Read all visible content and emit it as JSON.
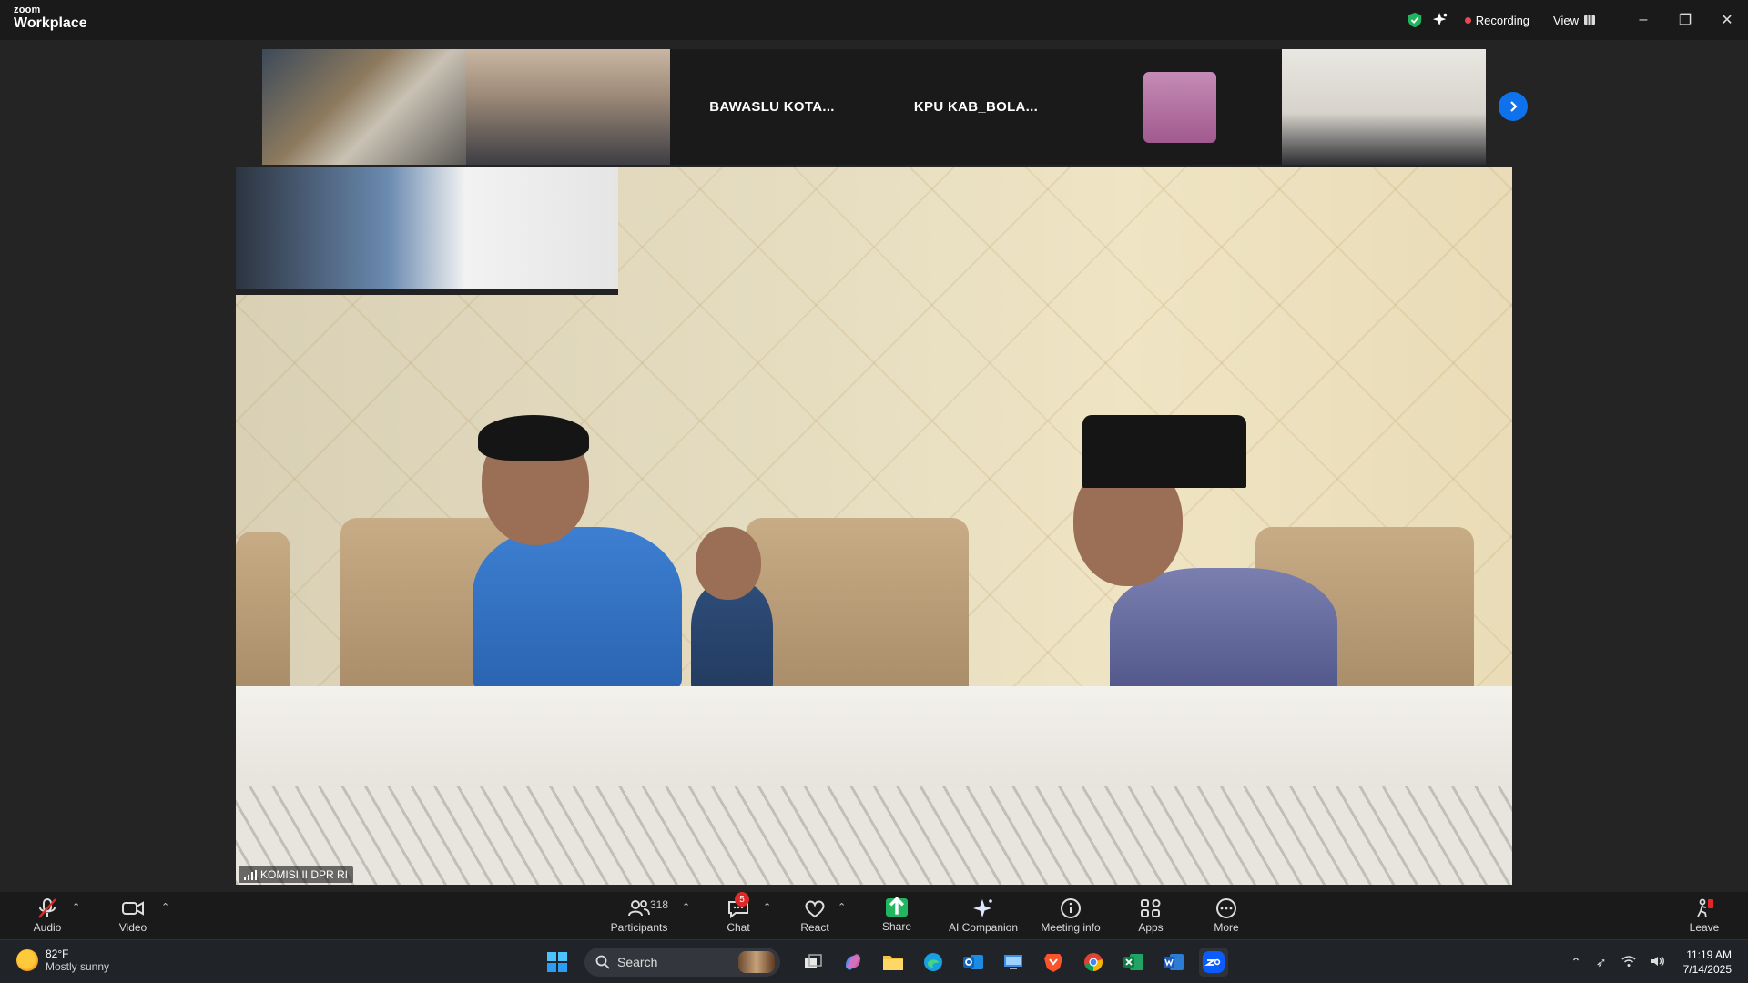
{
  "app": {
    "brand_small": "zoom",
    "brand_large": "Workplace"
  },
  "titlebar": {
    "recording_label": "Recording",
    "view_label": "View",
    "minimize": "–",
    "restore": "❐",
    "close": "✕"
  },
  "gallery": {
    "tiles": [
      {
        "name": "",
        "type": "video"
      },
      {
        "name": "",
        "type": "video"
      },
      {
        "name": "BAWASLU KOTA...",
        "type": "name-only"
      },
      {
        "name": "KPU KAB_BOLA...",
        "type": "name-only"
      },
      {
        "name": "",
        "type": "avatar"
      },
      {
        "name": "",
        "type": "video"
      }
    ]
  },
  "main_video": {
    "participant_label": "KOMISI II DPR RI"
  },
  "toolbar": {
    "audio": "Audio",
    "video": "Video",
    "participants": "Participants",
    "participants_count": "318",
    "chat": "Chat",
    "chat_badge": "5",
    "react": "React",
    "share": "Share",
    "ai_companion": "AI Companion",
    "meeting_info": "Meeting info",
    "apps": "Apps",
    "more": "More",
    "leave": "Leave"
  },
  "taskbar": {
    "weather_temp": "82°F",
    "weather_desc": "Mostly sunny",
    "search_placeholder": "Search",
    "time": "11:19 AM",
    "date": "7/14/2025"
  },
  "colors": {
    "accent_blue": "#0e72ed",
    "recording_red": "#e5484d",
    "share_green": "#21b65f",
    "badge_red": "#e02828"
  }
}
